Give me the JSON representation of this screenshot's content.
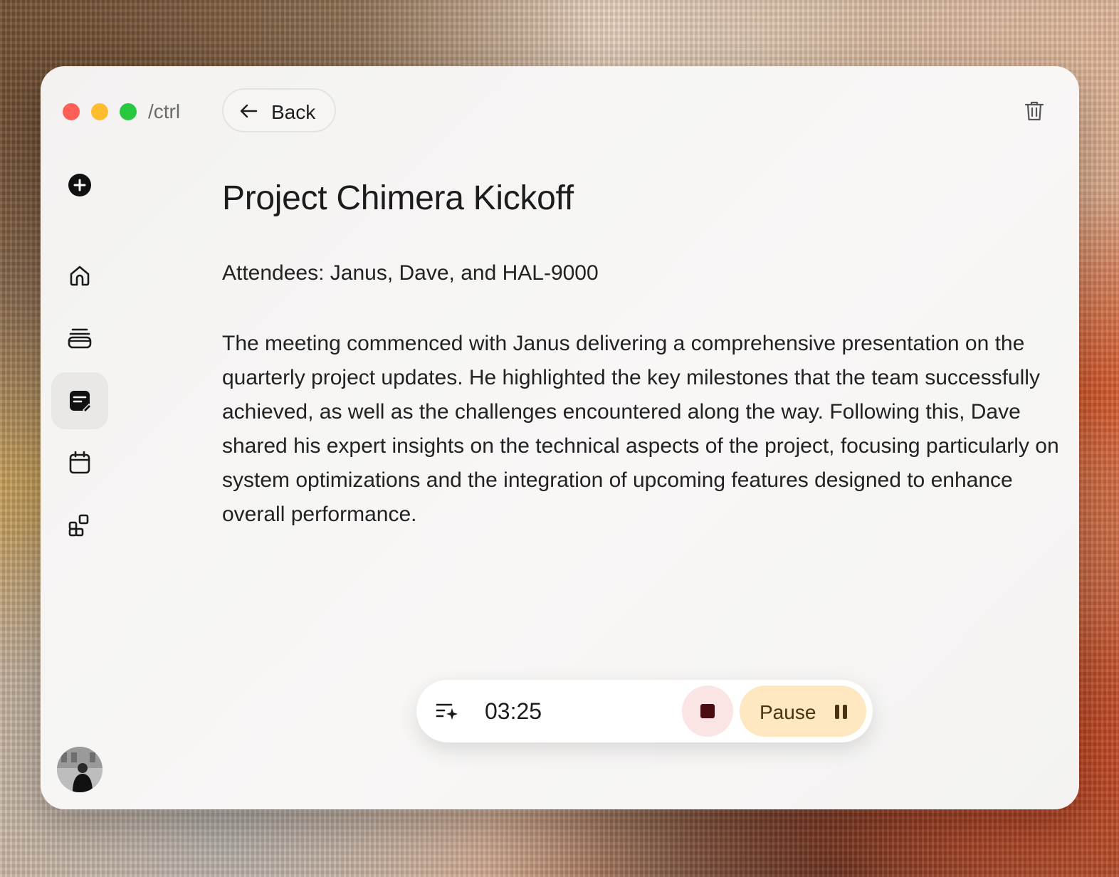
{
  "window": {
    "app_name": "/ctrl"
  },
  "header": {
    "back_label": "Back"
  },
  "sidebar": {
    "items": [
      {
        "name": "new",
        "icon": "plus-circle-icon"
      },
      {
        "name": "home",
        "icon": "home-icon"
      },
      {
        "name": "stack",
        "icon": "stack-icon"
      },
      {
        "name": "notes",
        "icon": "note-edit-icon",
        "active": true
      },
      {
        "name": "calendar",
        "icon": "calendar-icon"
      },
      {
        "name": "apps",
        "icon": "apps-icon"
      }
    ]
  },
  "note": {
    "title": "Project Chimera Kickoff",
    "attendees": "Attendees: Janus, Dave, and HAL-9000",
    "body": "The meeting commenced with Janus delivering a comprehensive presentation on the quarterly project updates. He highlighted the key milestones that the team successfully achieved, as well as the challenges encountered along the way. Following this, Dave shared his expert insights on the technical aspects of the project, focusing particularly on system optimizations and the integration of upcoming features designed to enhance overall performance."
  },
  "recorder": {
    "elapsed": "03:25",
    "pause_label": "Pause"
  },
  "colors": {
    "stop_bg": "#fbe4e4",
    "stop_fg": "#4a0c10",
    "pause_bg": "#fde8c2",
    "active_sidebar_bg": "#e9e8e7"
  }
}
